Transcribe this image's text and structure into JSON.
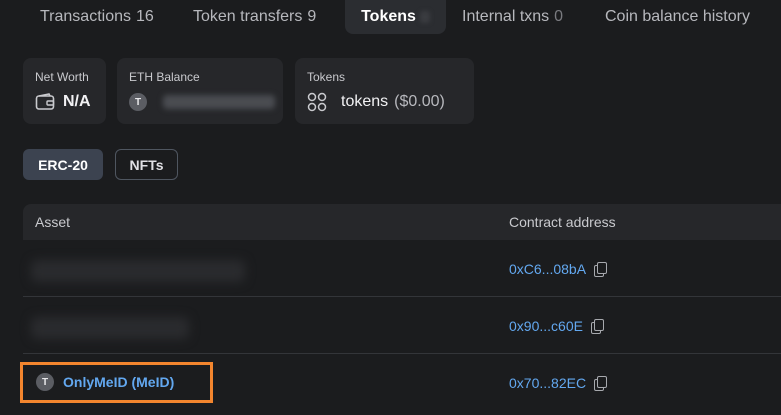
{
  "tabs": [
    {
      "label": "Transactions",
      "count": "16"
    },
    {
      "label": "Token transfers",
      "count": "9"
    },
    {
      "label": "Tokens",
      "count": ""
    },
    {
      "label": "Internal txns",
      "count": "0"
    },
    {
      "label": "Coin balance history",
      "count": ""
    }
  ],
  "cards": {
    "net_worth": {
      "label": "Net Worth",
      "value": "N/A",
      "icon": "wallet-icon"
    },
    "eth_balance": {
      "label": "ETH Balance",
      "icon_letter": "T"
    },
    "tokens": {
      "label": "Tokens",
      "value": "tokens",
      "usd": "($0.00)",
      "icon": "grid-icon"
    }
  },
  "filters": {
    "erc20": "ERC-20",
    "nfts": "NFTs"
  },
  "table": {
    "headers": {
      "asset": "Asset",
      "contract": "Contract address"
    },
    "rows": [
      {
        "asset": "",
        "contract": "0xC6...08bA"
      },
      {
        "asset": "",
        "contract": "0x90...c60E"
      },
      {
        "asset": "OnlyMeID (MeID)",
        "asset_icon_letter": "T",
        "contract": "0x70...82EC"
      }
    ]
  },
  "colors": {
    "accent": "#63a8f0",
    "highlight": "#f2852e",
    "background": "#1b1c1e"
  }
}
